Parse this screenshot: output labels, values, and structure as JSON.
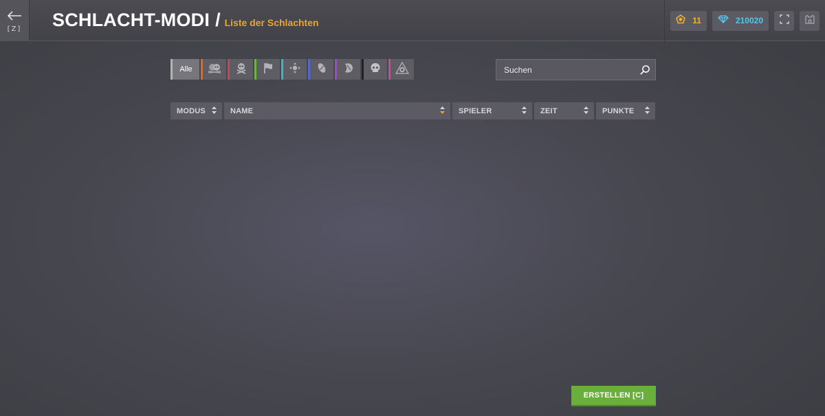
{
  "header": {
    "back_key": "[Z]",
    "title": "SCHLACHT-MODI",
    "separator": "/",
    "subtitle": "Liste der Schlachten"
  },
  "currencies": {
    "rank": {
      "icon": "rank-pentagon-icon",
      "value": "11",
      "color": "#f2b22a"
    },
    "gems": {
      "icon": "diamond-icon",
      "value": "210020",
      "color": "#53c6ea"
    }
  },
  "filters": {
    "all_label": "Alle",
    "modes": [
      {
        "icon": "skull-crossed-pair-icon",
        "color": "#c0724a"
      },
      {
        "icon": "skull-crossbones-icon",
        "color": "#c24a55"
      },
      {
        "icon": "flag-icon",
        "color": "#6fb24a"
      },
      {
        "icon": "crosshair-diamond-icon",
        "color": "#3fb7b7"
      },
      {
        "icon": "rugby-ball-icon",
        "color": "#5269c7"
      },
      {
        "icon": "juggernaut-shield-icon",
        "color": "#9a4cc9"
      },
      {
        "icon": "skull-icon",
        "color": "#222226"
      },
      {
        "icon": "triangle-orb-icon",
        "color": "#c84c9b"
      }
    ]
  },
  "search": {
    "placeholder": "Suchen"
  },
  "table": {
    "columns": [
      "MODUS",
      "NAME",
      "SPIELER",
      "ZEIT",
      "PUNKTE"
    ]
  },
  "actions": {
    "create_label": "ERSTELLEN [C]"
  }
}
